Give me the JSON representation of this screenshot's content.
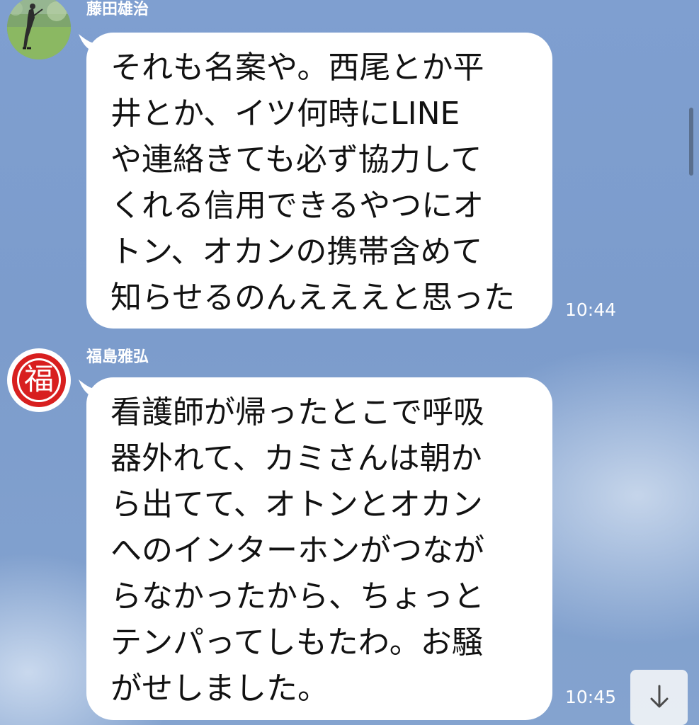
{
  "chat": {
    "messages": [
      {
        "sender": "藤田雄治",
        "text": "それも名案や。西尾とか平\n井とか、イツ何時にLINE\nや連絡きても必ず協力して\nくれる信用できるやつにオ\nトン、オカンの携帯含めて\n知らせるのんえええと思った",
        "time": "10:44",
        "avatar_icon": "golfer-photo-avatar"
      },
      {
        "sender": "福島雅弘",
        "text": "看護師が帰ったとこで呼吸\n器外れて、カミさんは朝か\nら出てて、オトンとオカン\nへのインターホンがつなが\nらなかったから、ちょっと\nテンパってしもたわ。お騒\nがせしました。",
        "time": "10:45",
        "avatar_label": "福",
        "avatar_icon": "fuku-emblem-avatar"
      }
    ],
    "scroll_button_icon": "arrow-down-icon"
  },
  "colors": {
    "background": "#7f9fd0",
    "bubble": "#ffffff",
    "text": "#121212",
    "meta_text": "#ffffff",
    "emblem_red": "#d81f1f"
  }
}
